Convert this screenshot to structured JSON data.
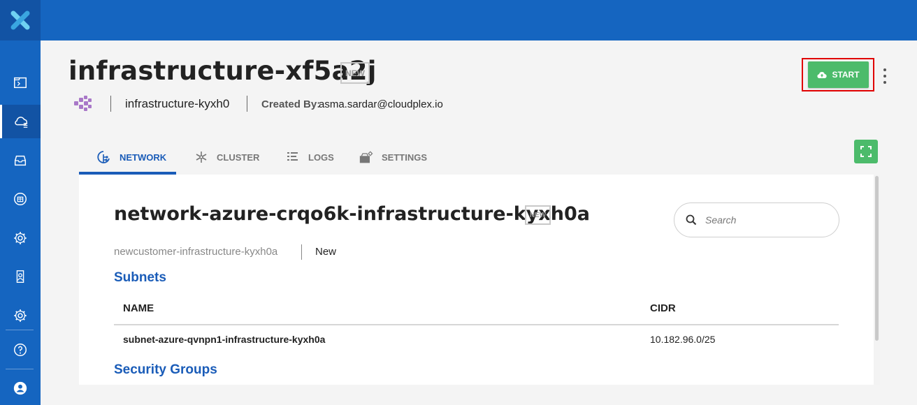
{
  "app": {
    "icons": {
      "logo": "app-logo-x",
      "nav": [
        "terminal-icon",
        "cloud-icon",
        "inbox-icon",
        "globe-icon",
        "gear-icon",
        "user-shield-icon",
        "settings-icon",
        "help-icon",
        "user-avatar-icon"
      ]
    },
    "colors": {
      "primary": "#1565c0",
      "accent": "#4cbb6b",
      "highlight": "#e00000"
    }
  },
  "header": {
    "title": "infrastructure-xf5a2j",
    "status_badge": "NEW",
    "cluster_name": "infrastructure-kyxh0",
    "created_by_label": "Created By:",
    "created_by_value": "asma.sardar@cloudplex.io",
    "start_label": "START"
  },
  "tabs": [
    {
      "label": "NETWORK",
      "icon": "network-icon",
      "active": true
    },
    {
      "label": "CLUSTER",
      "icon": "cluster-icon",
      "active": false
    },
    {
      "label": "LOGS",
      "icon": "logs-icon",
      "active": false
    },
    {
      "label": "SETTINGS",
      "icon": "settings-box-icon",
      "active": false
    }
  ],
  "network": {
    "title": "network-azure-crqo6k-infrastructure-kyxh0a",
    "badge": "NEW",
    "customer": "newcustomer-infrastructure-kyxh0a",
    "status": "New",
    "search_placeholder": "Search"
  },
  "subnets": {
    "heading": "Subnets",
    "columns": [
      "NAME",
      "CIDR"
    ],
    "rows": [
      {
        "name": "subnet-azure-qvnpn1-infrastructure-kyxh0a",
        "cidr": "10.182.96.0/25"
      }
    ]
  },
  "security_groups": {
    "heading": "Security Groups"
  }
}
